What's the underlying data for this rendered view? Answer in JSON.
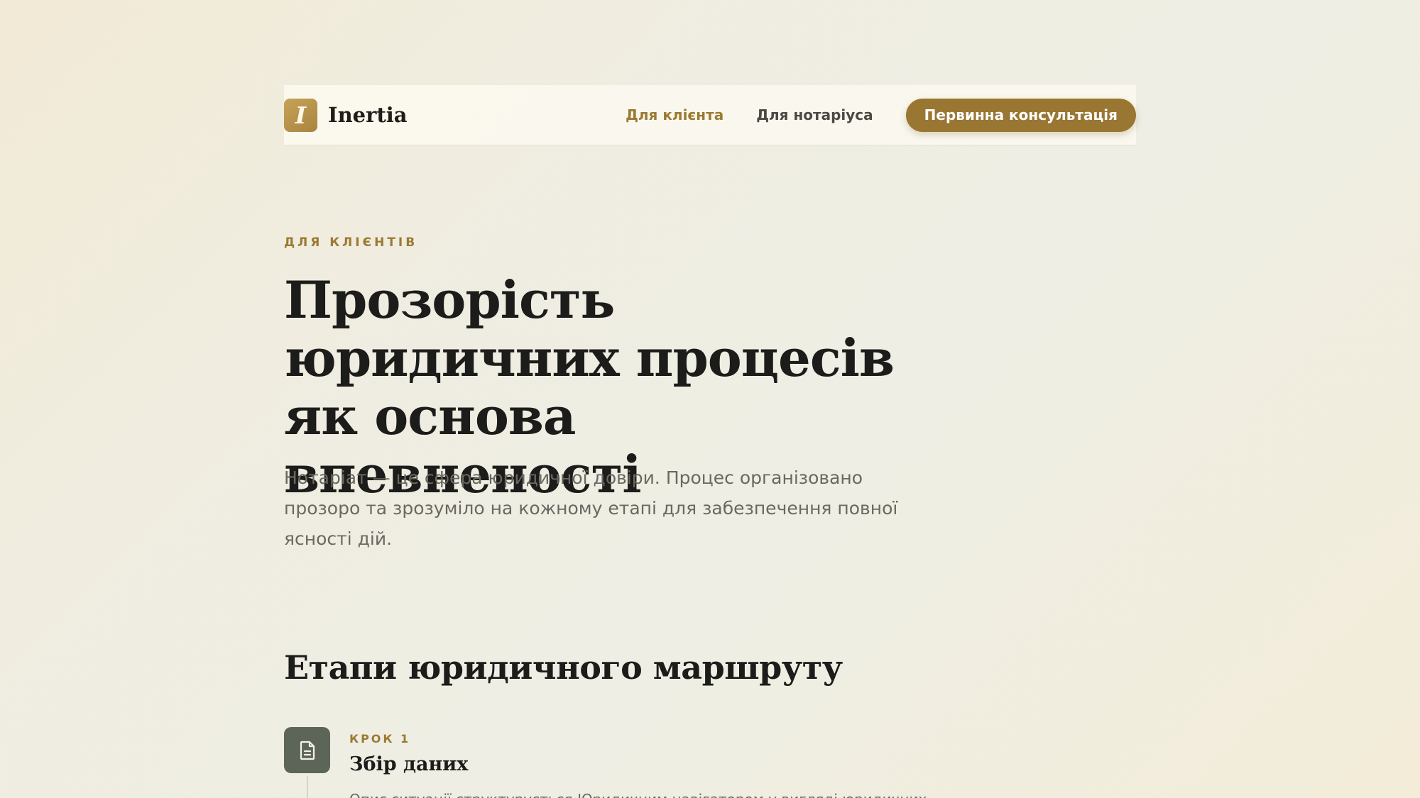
{
  "header": {
    "logo_letter": "I",
    "brand_name": "Inertia",
    "nav": [
      {
        "label": "Для клієнта",
        "active": true
      },
      {
        "label": "Для нотаріуса",
        "active": false
      }
    ],
    "cta_label": "Первинна консультація"
  },
  "hero": {
    "eyebrow": "ДЛЯ КЛІЄНТІВ",
    "title": "Прозорість юридичних процесів як основа впевненості",
    "description": "Нотаріат — це сфера юридичної довіри. Процес організовано прозоро та зрозуміло на кожному етапі для забезпечення повної ясності дій."
  },
  "route": {
    "title": "Етапи юридичного маршруту",
    "steps": [
      {
        "icon": "document-icon",
        "label": "КРОК 1",
        "title": "Збір даних",
        "text": "Опис ситуації структурується Юридичним навігатором у вигляді юридичних..."
      }
    ]
  },
  "colors": {
    "accent": "#9a7633",
    "accent_text": "#9b7a33",
    "step_icon_bg": "#5c6558",
    "heading": "#1c1c1a",
    "muted_text": "#6a6861"
  }
}
